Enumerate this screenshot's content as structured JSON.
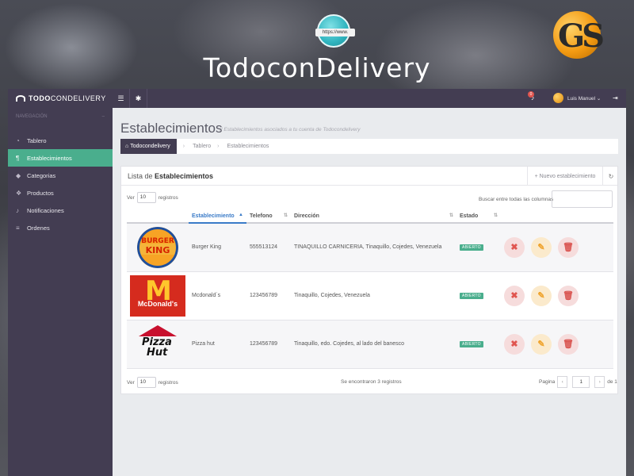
{
  "banner": {
    "globe_text": "https://www.",
    "title": "TodoconDelivery",
    "brand_logo_text": "GS"
  },
  "app": {
    "brand_bold": "TODO",
    "brand_light": "CONDELIVERY"
  },
  "sidebar": {
    "section_label": "NAVEGACIÓN",
    "section_toggle": "–",
    "items": [
      {
        "label": "Tablero",
        "icon": "dashboard-icon",
        "glyph": "◔",
        "active": false
      },
      {
        "label": "Establecimientos",
        "icon": "utensils-icon",
        "glyph": "¶",
        "active": true
      },
      {
        "label": "Categorias",
        "icon": "tags-icon",
        "glyph": "◆",
        "active": false
      },
      {
        "label": "Productos",
        "icon": "cubes-icon",
        "glyph": "❖",
        "active": false
      },
      {
        "label": "Notificaciones",
        "icon": "bell-icon",
        "glyph": "♪",
        "active": false
      },
      {
        "label": "Ordenes",
        "icon": "cart-icon",
        "glyph": "≡",
        "active": false
      }
    ]
  },
  "topbar": {
    "menu_glyph": "☰",
    "settings_glyph": "✱",
    "notification_count": "0",
    "bell_glyph": "♪",
    "user_name": "Luis Manuel",
    "user_caret": "⌄",
    "logout_glyph": "⇥"
  },
  "page": {
    "title": "Establecimientos",
    "subtitle": "// Establecimientos asociados a tu cuenta de Todocondelivery",
    "breadcrumb": {
      "home_glyph": "⌂",
      "home": "Todocondelivery",
      "items": [
        "Tablero",
        "Establecimientos"
      ],
      "separator": "›"
    }
  },
  "panel": {
    "title_prefix": "Lista de ",
    "title_bold": "Establecimientos",
    "new_button": "Nuevo establecimiento",
    "new_glyph": "+",
    "refresh_glyph": "↻",
    "length_label_pre": "Ver",
    "length_value": "10",
    "length_label_post": "registros",
    "search_label": "Buscar entre todas las columnas",
    "search_value": "",
    "columns": [
      "",
      "Establecimiento",
      "Telefono",
      "Dirección",
      "Estado",
      ""
    ],
    "sort_glyph": "▲",
    "unsorted_glyph": "⇅",
    "rows": [
      {
        "logo": "burger-king-logo",
        "name": "Burger King",
        "phone": "555513124",
        "address": "TINAQUILLO CARNICERIA, Tinaquillo, Cojedes, Venezuela",
        "status": "ABIERTO"
      },
      {
        "logo": "mcdonalds-logo",
        "name": "Mcdonald´s",
        "phone": "123456789",
        "address": "Tinaquillo, Cojedes, Venezuela",
        "status": "ABIERTO"
      },
      {
        "logo": "pizza-hut-logo",
        "name": "Pizza hut",
        "phone": "123456789",
        "address": "Tinaquillo, edo. Cojedes, al lado del banesco",
        "status": "ABIERTO"
      }
    ],
    "actions": {
      "close_glyph": "✖",
      "edit_glyph": "✎",
      "trash_glyph": "🗑"
    },
    "footer_info": "Se encontraron 3 registros",
    "pager_label": "Pagina",
    "pager_prev": "‹",
    "pager_page": "1",
    "pager_next": "›",
    "pager_of": "de 1"
  },
  "logos": {
    "bk_word1": "BURGER",
    "bk_word2": "KING",
    "mcd_arch": "M",
    "mcd_name": "McDonald's",
    "ph_word1": "Pizza",
    "ph_word2": "Hut"
  },
  "colors": {
    "sidebar": "#433d52",
    "accent": "#4aae8d",
    "danger": "#e0554f",
    "warning": "#efa22a",
    "link": "#3a7bc8"
  }
}
